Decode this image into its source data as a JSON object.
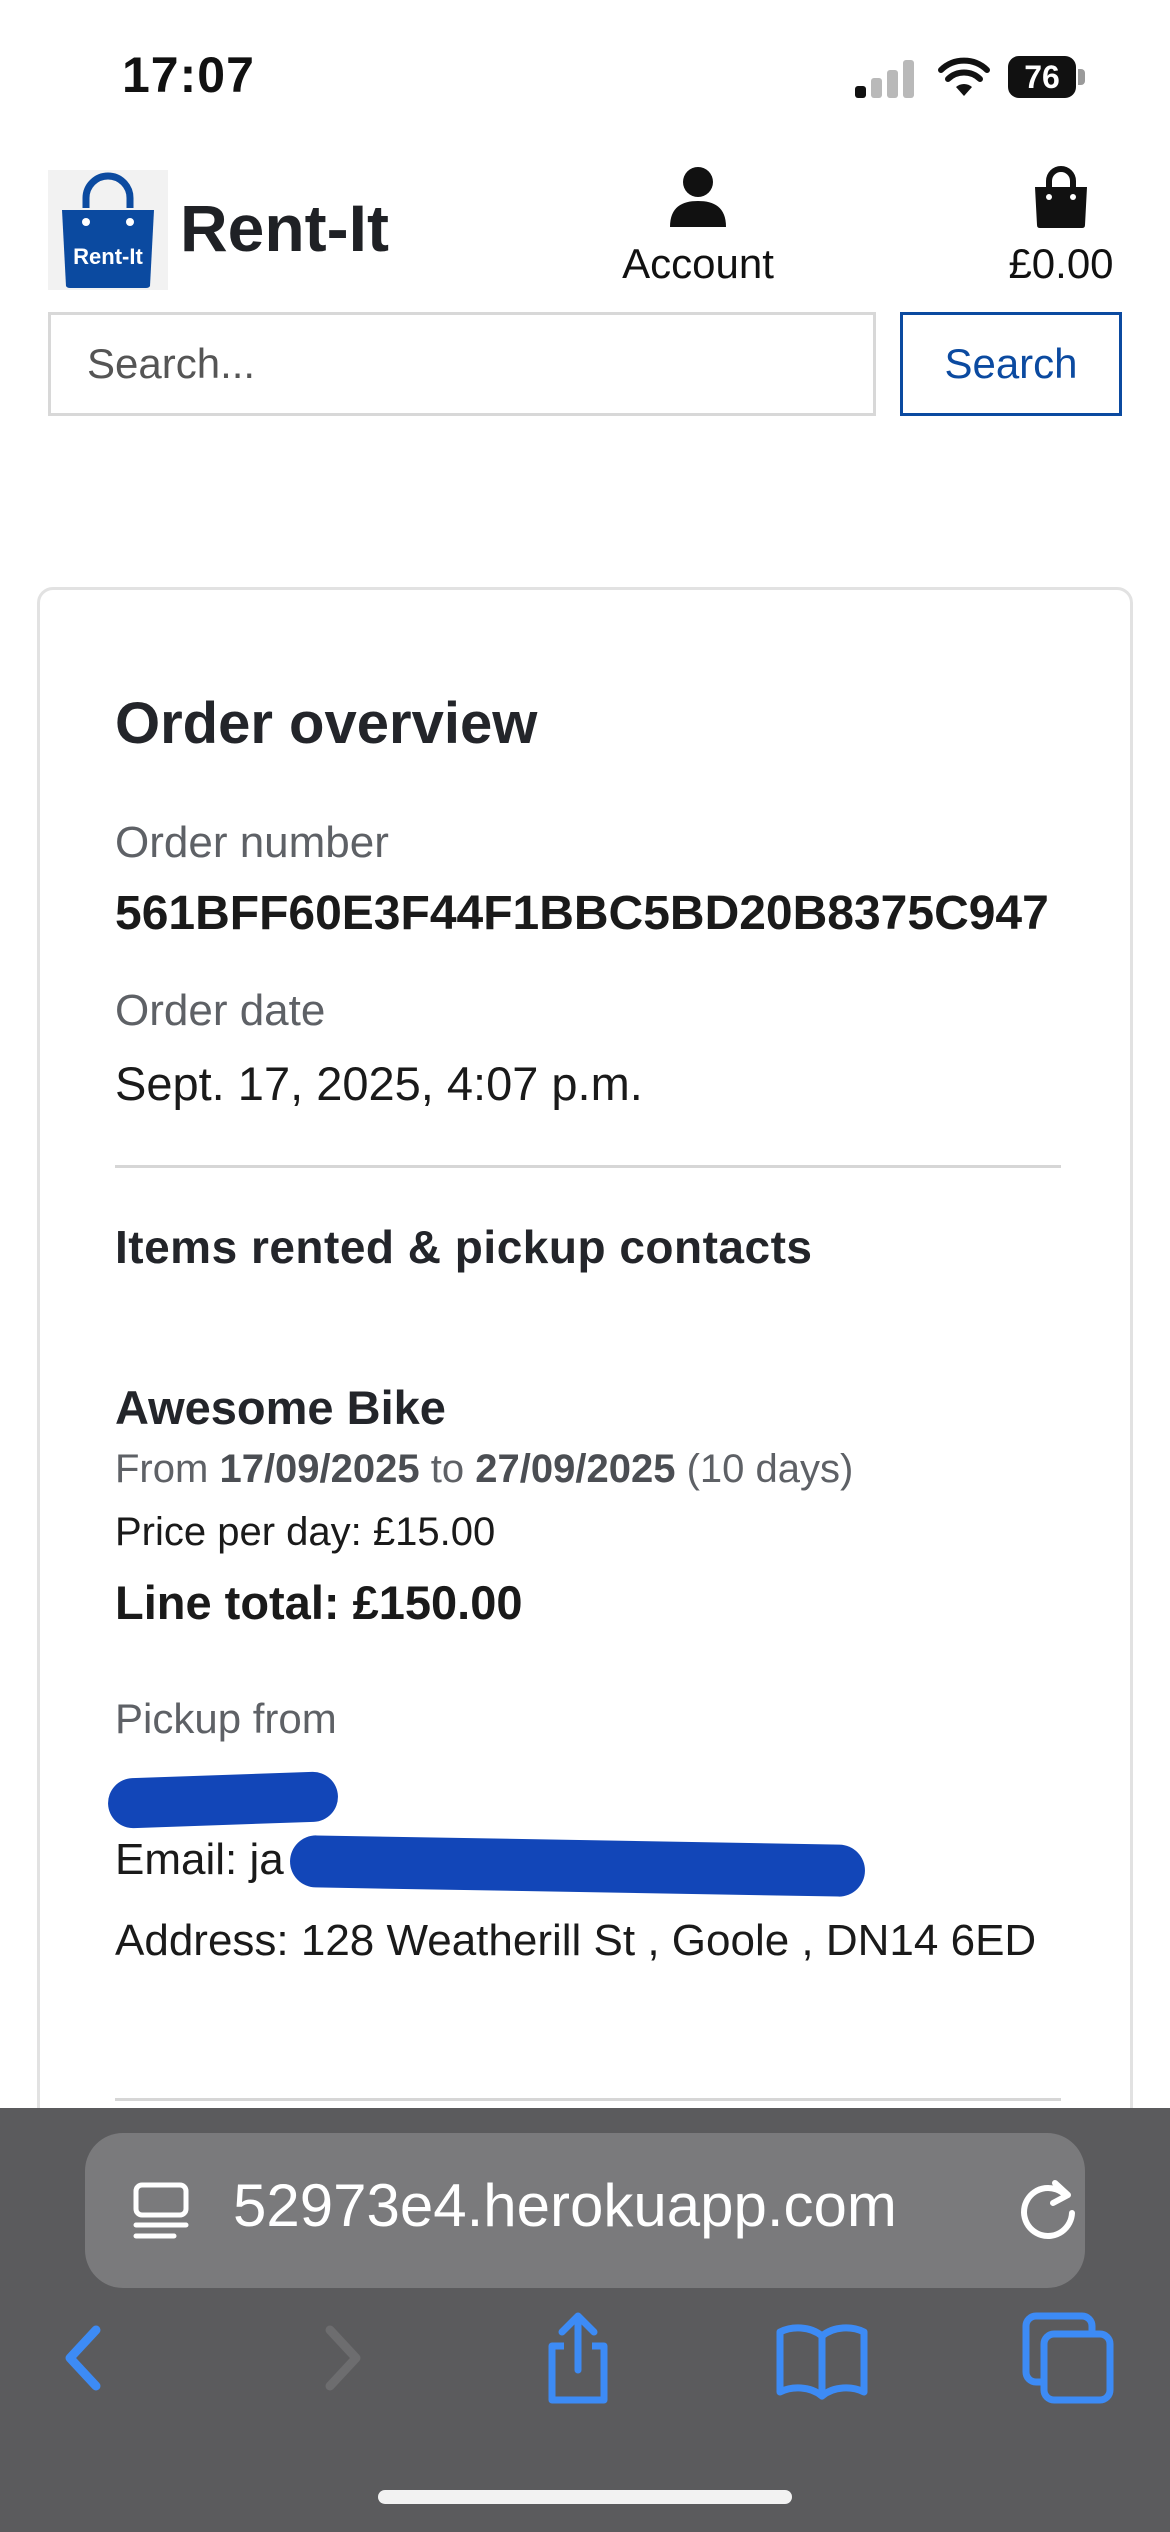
{
  "status_bar": {
    "time": "17:07",
    "battery": "76"
  },
  "header": {
    "logo_text": "Rent-It",
    "brand": "Rent-It",
    "account_label": "Account",
    "bag_total": "£0.00"
  },
  "search": {
    "placeholder": "Search...",
    "button_label": "Search"
  },
  "order": {
    "title": "Order overview",
    "number_label": "Order number",
    "number": "561BFF60E3F44F1BBC5BD20B8375C947",
    "date_label": "Order date",
    "date": "Sept. 17, 2025, 4:07 p.m.",
    "section_title": "Items rented & pickup contacts",
    "item": {
      "name": "Awesome Bike",
      "from_label": "From",
      "start": "17/09/2025",
      "to_label": "to",
      "end": "27/09/2025",
      "duration": "(10 days)",
      "price_per_day": "Price per day: £15.00",
      "line_total": "Line total: £150.00"
    },
    "pickup": {
      "label": "Pickup from",
      "email": "Email: ja",
      "address": "Address: 128 Weatherill St , Goole , DN14 6ED"
    }
  },
  "browser": {
    "url": "52973e4.herokuapp.com"
  },
  "colors": {
    "brand_blue": "#0b4aa0",
    "browser_bar": "#5b5b5d",
    "toolbar_blue": "#3d8bf5"
  },
  "icons": [
    "signal-icon",
    "wifi-icon",
    "battery-icon",
    "bag-logo-icon",
    "account-icon",
    "bag-icon",
    "reader-icon",
    "reload-icon",
    "back-icon",
    "forward-icon",
    "share-icon",
    "bookmarks-icon",
    "tabs-icon"
  ]
}
